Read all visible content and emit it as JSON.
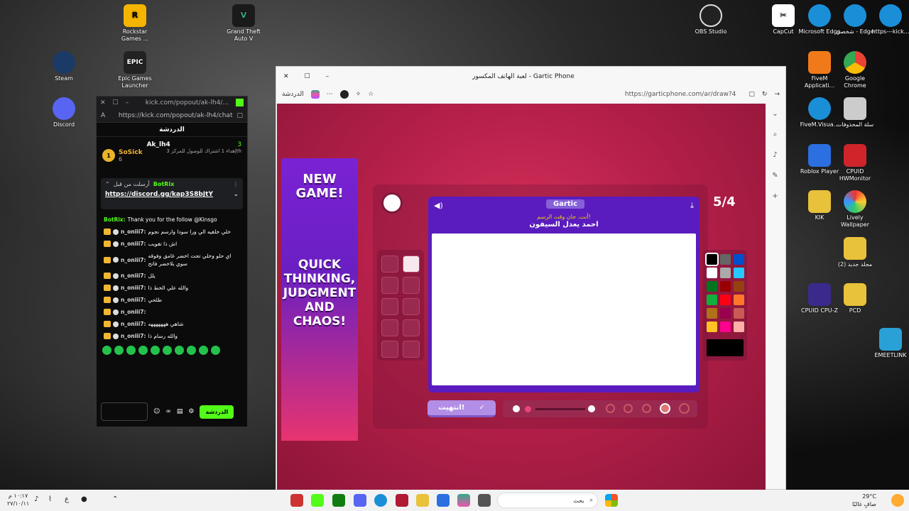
{
  "desktop": {
    "icons_left": [
      {
        "label": "Rockstar Games ..."
      },
      {
        "label": "Grand Theft Auto V"
      },
      {
        "label": "Steam"
      },
      {
        "label": "Epic Games Launcher"
      },
      {
        "label": "Discord"
      },
      {
        "label": "OBS Studio"
      }
    ],
    "icons_right": [
      {
        "label": "CapCut"
      },
      {
        "label": "Microsoft Edge"
      },
      {
        "label": "شخصي - Edge"
      },
      {
        "label": "https---kick..."
      },
      {
        "label": "FiveM Applicati..."
      },
      {
        "label": "Google Chrome"
      },
      {
        "label": "FiveM.Visua..."
      },
      {
        "label": "سلة المحذوفات"
      },
      {
        "label": "Roblox Player"
      },
      {
        "label": "CPUID HWMonitor"
      },
      {
        "label": "KIK"
      },
      {
        "label": "Lively Wallpaper"
      },
      {
        "label": "مجلد جديد (2)"
      },
      {
        "label": "CPUID CPU-Z"
      },
      {
        "label": "PCD"
      },
      {
        "label": "EMEETLINK"
      }
    ]
  },
  "chat": {
    "title_url": "kick.com/popout/ak-lh4/...",
    "url": "https://kick.com/popout/ak-lh4/chat",
    "header": "الدردشة",
    "top_user": {
      "name": "SoSick",
      "rank": "1",
      "count": "6"
    },
    "streamer": {
      "name": "Ak_lh4",
      "count": "3",
      "desc": "إهداء 1 اشتراك للوصول للمركز 3th"
    },
    "pinned": {
      "by": "أرسلت من قبل",
      "sender": "BotRix",
      "link": "https://discord.gg/kap3S8bJtY"
    },
    "first_msg": {
      "user": "BotRix:",
      "text": "Thank you for the follow @Kinsgo"
    },
    "messages": [
      {
        "user": "n_oniii7:",
        "text": "خلي خلقيه الي ورا سودا وارسم نجوم"
      },
      {
        "user": "n_oniii7:",
        "text": "اش ذا تقويب"
      },
      {
        "user": "n_oniii7:",
        "text": "اي حلو وخلي تحت اخضر غامق وفوقه سوي بلاخضر فاتح"
      },
      {
        "user": "n_oniii7:",
        "text": "يلل"
      },
      {
        "user": "n_oniii7:",
        "text": "والله علي الخط ذا"
      },
      {
        "user": "n_oniii7:",
        "text": "طلحي"
      },
      {
        "user": "n_oniii7:",
        "text": ""
      },
      {
        "user": "n_oniii7:",
        "text": "شاهي هههههههه"
      },
      {
        "user": "n_oniii7:",
        "text": "والله رسام ذا"
      }
    ],
    "send_label": "الدردشة"
  },
  "browser": {
    "tab_title": "لعبة الهاتف المكسور - Gartic Phone",
    "profile": "الدردشة",
    "url": "https://garticphone.com/ar/draw?4"
  },
  "game": {
    "logo": "Gartic",
    "prompt_hint": "أنت، حان وقت الرسم!",
    "prompt": "احمد يعدل السيفون",
    "counter": "5/4",
    "done_label": "انتهيت!",
    "ad": {
      "line1": "NEW GAME!",
      "line2": "QUICK THINKING, JUDGMENT AND CHAOS!"
    },
    "colors": [
      "#000000",
      "#666666",
      "#0050cd",
      "#ffffff",
      "#aaaaaa",
      "#26c9ff",
      "#017420",
      "#990000",
      "#964112",
      "#11b03c",
      "#ff0013",
      "#ff7829",
      "#b0701c",
      "#99004e",
      "#cb5a57",
      "#ffc126",
      "#ff008f",
      "#feafa8"
    ]
  },
  "taskbar": {
    "search": "بحث",
    "weather_temp": "29°C",
    "weather_desc": "صافٍ غالبًا",
    "time": "١٠:١٧ م",
    "date": "٢٧/١٠/١١",
    "lang": "ع"
  }
}
